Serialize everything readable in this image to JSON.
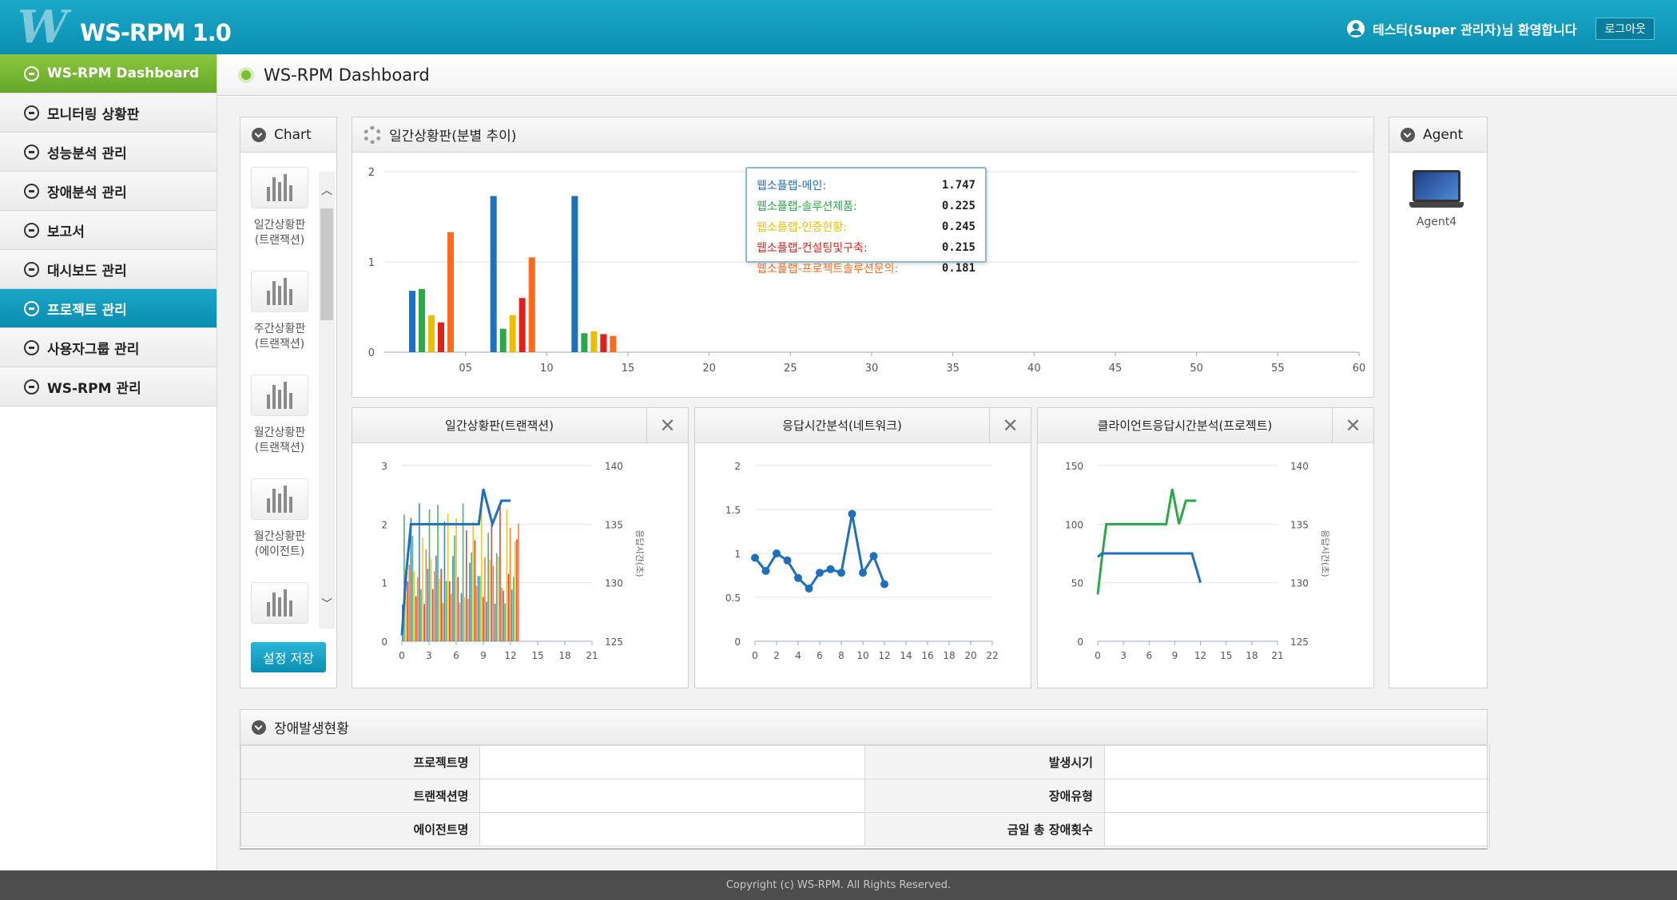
{
  "header": {
    "logo_mark": "W",
    "logo_text": "WS-RPM 1.0",
    "welcome": "테스터(Super 관리자)님 환영합니다",
    "logout_label": "로그아웃"
  },
  "sidebar": {
    "items": [
      {
        "label": "WS-RPM Dashboard",
        "state": "active-green"
      },
      {
        "label": "모니터링 상황판"
      },
      {
        "label": "성능분석 관리"
      },
      {
        "label": "장애분석 관리"
      },
      {
        "label": "보고서"
      },
      {
        "label": "대시보드 관리"
      },
      {
        "label": "프로젝트 관리",
        "state": "active-blue"
      },
      {
        "label": "사용자그룹 관리"
      },
      {
        "label": "WS-RPM 관리"
      }
    ]
  },
  "page": {
    "title": "WS-RPM Dashboard"
  },
  "chart_panel": {
    "title": "Chart",
    "items": [
      {
        "line1": "일간상황판",
        "line2": "(트랜잭션)"
      },
      {
        "line1": "주간상황판",
        "line2": "(트랜잭션)"
      },
      {
        "line1": "월간상황판",
        "line2": "(트랜잭션)"
      },
      {
        "line1": "월간상황판",
        "line2": "(에이전트)"
      }
    ],
    "save_label": "설정 저장"
  },
  "agent_panel": {
    "title": "Agent",
    "agents": [
      "Agent4"
    ]
  },
  "main_chart": {
    "title": "일간상황판(분별 추이)"
  },
  "tooltip": {
    "rows": [
      {
        "label": "웹소플랩-메인:",
        "value": "1.747",
        "color": "#1f6fbf"
      },
      {
        "label": "웹소플랩-솔루션제품:",
        "value": "0.225",
        "color": "#2aa84a"
      },
      {
        "label": "웹소플랩-인증현황:",
        "value": "0.245",
        "color": "#e8c000"
      },
      {
        "label": "웹소플랩-컨설팅및구축:",
        "value": "0.215",
        "color": "#e0201b"
      },
      {
        "label": "웹소플랩-프로젝트솔루션문의:",
        "value": "0.181",
        "color": "#ff6a1a"
      }
    ]
  },
  "small_charts": [
    {
      "title": "일간상황판(트랜잭션)"
    },
    {
      "title": "응답시간분석(네트워크)"
    },
    {
      "title": "클라이언트응답시간분석(프로젝트)"
    }
  ],
  "close_symbol": "✕",
  "fault_panel": {
    "title": "장애발생현황",
    "rows": [
      {
        "left_label": "프로젝트명",
        "right_label": "발생시기"
      },
      {
        "left_label": "트랜잭션명",
        "right_label": "장애유형"
      },
      {
        "left_label": "에이전트명",
        "right_label": "금일 총 장애횟수"
      }
    ]
  },
  "footer": {
    "text": "Copyright (c) WS-RPM. All Rights Reserved."
  },
  "chart_data": [
    {
      "type": "bar",
      "title": "일간상황판(분별 추이)",
      "xlim": [
        0,
        60
      ],
      "ylim": [
        0,
        2
      ],
      "x_ticks": [
        "05",
        "10",
        "15",
        "20",
        "25",
        "30",
        "35",
        "40",
        "45",
        "50",
        "55",
        "60"
      ],
      "y_ticks": [
        0,
        1,
        2
      ],
      "x": [
        3,
        8,
        13
      ],
      "series": [
        {
          "color": "#1f6fbf",
          "values": [
            0.68,
            1.73,
            1.73
          ]
        },
        {
          "color": "#2aa84a",
          "values": [
            0.7,
            0.26,
            0.21
          ]
        },
        {
          "color": "#e8c000",
          "values": [
            0.41,
            0.41,
            0.23
          ]
        },
        {
          "color": "#e0201b",
          "values": [
            0.33,
            0.6,
            0.2
          ]
        },
        {
          "color": "#ff6a1a",
          "values": [
            1.33,
            1.05,
            0.18
          ]
        }
      ]
    },
    {
      "type": "line",
      "title": "일간상황판(트랜잭션)",
      "x_ticks": [
        0,
        3,
        6,
        9,
        12,
        15,
        18,
        21
      ],
      "ylim": [
        0,
        3
      ],
      "y_ticks": [
        0,
        1,
        2,
        3
      ],
      "y2lim": [
        125,
        140
      ],
      "y2_ticks": [
        125,
        130,
        135,
        140
      ],
      "y2label": "응답시간(초)",
      "series": [
        {
          "color": "#1f6fbf",
          "x": [
            0,
            0.5,
            1,
            1.5,
            3,
            6,
            8.5,
            9,
            10,
            11,
            12
          ],
          "y": [
            0.1,
            1.2,
            2.0,
            2.0,
            2.0,
            2.0,
            2.0,
            2.6,
            2.0,
            2.4,
            2.4
          ]
        }
      ],
      "bars": {
        "x_range": [
          0,
          13
        ],
        "max": 2.5,
        "colors": [
          "#1f6fbf",
          "#2aa84a",
          "#e8c000",
          "#e0201b",
          "#ff6a1a"
        ]
      }
    },
    {
      "type": "line",
      "title": "응답시간분석(네트워크)",
      "x_ticks": [
        0,
        2,
        4,
        6,
        8,
        10,
        12,
        14,
        16,
        18,
        20,
        22
      ],
      "ylim": [
        0,
        2
      ],
      "y_ticks": [
        "0",
        "0.5",
        "1",
        "1.5",
        "2"
      ],
      "series": [
        {
          "color": "#1f6fbf",
          "x": [
            0,
            1,
            2,
            3,
            4,
            5,
            6,
            7,
            8,
            9,
            10,
            11,
            12
          ],
          "y": [
            0.95,
            0.8,
            1.0,
            0.92,
            0.72,
            0.6,
            0.78,
            0.82,
            0.78,
            1.45,
            0.78,
            0.97,
            0.65
          ]
        }
      ]
    },
    {
      "type": "line",
      "title": "클라이언트응답시간분석(프로젝트)",
      "x_ticks": [
        0,
        3,
        6,
        9,
        12,
        15,
        18,
        21
      ],
      "ylim": [
        0,
        150
      ],
      "y_ticks": [
        0,
        50,
        100,
        150
      ],
      "y2lim": [
        125,
        140
      ],
      "y2_ticks": [
        125,
        130,
        135,
        140
      ],
      "y2label": "응답시간(초)",
      "series": [
        {
          "color": "#2aa84a",
          "x": [
            0,
            0.5,
            1,
            3,
            6,
            8,
            8.7,
            9.5,
            10.3,
            11.5
          ],
          "y": [
            40,
            72,
            100,
            100,
            100,
            100,
            130,
            100,
            120,
            120
          ]
        },
        {
          "color": "#1f6fbf",
          "x": [
            0,
            0.5,
            1,
            3,
            6,
            9,
            11,
            12
          ],
          "y": [
            72,
            75,
            75,
            75,
            75,
            75,
            75,
            50
          ]
        }
      ]
    }
  ]
}
